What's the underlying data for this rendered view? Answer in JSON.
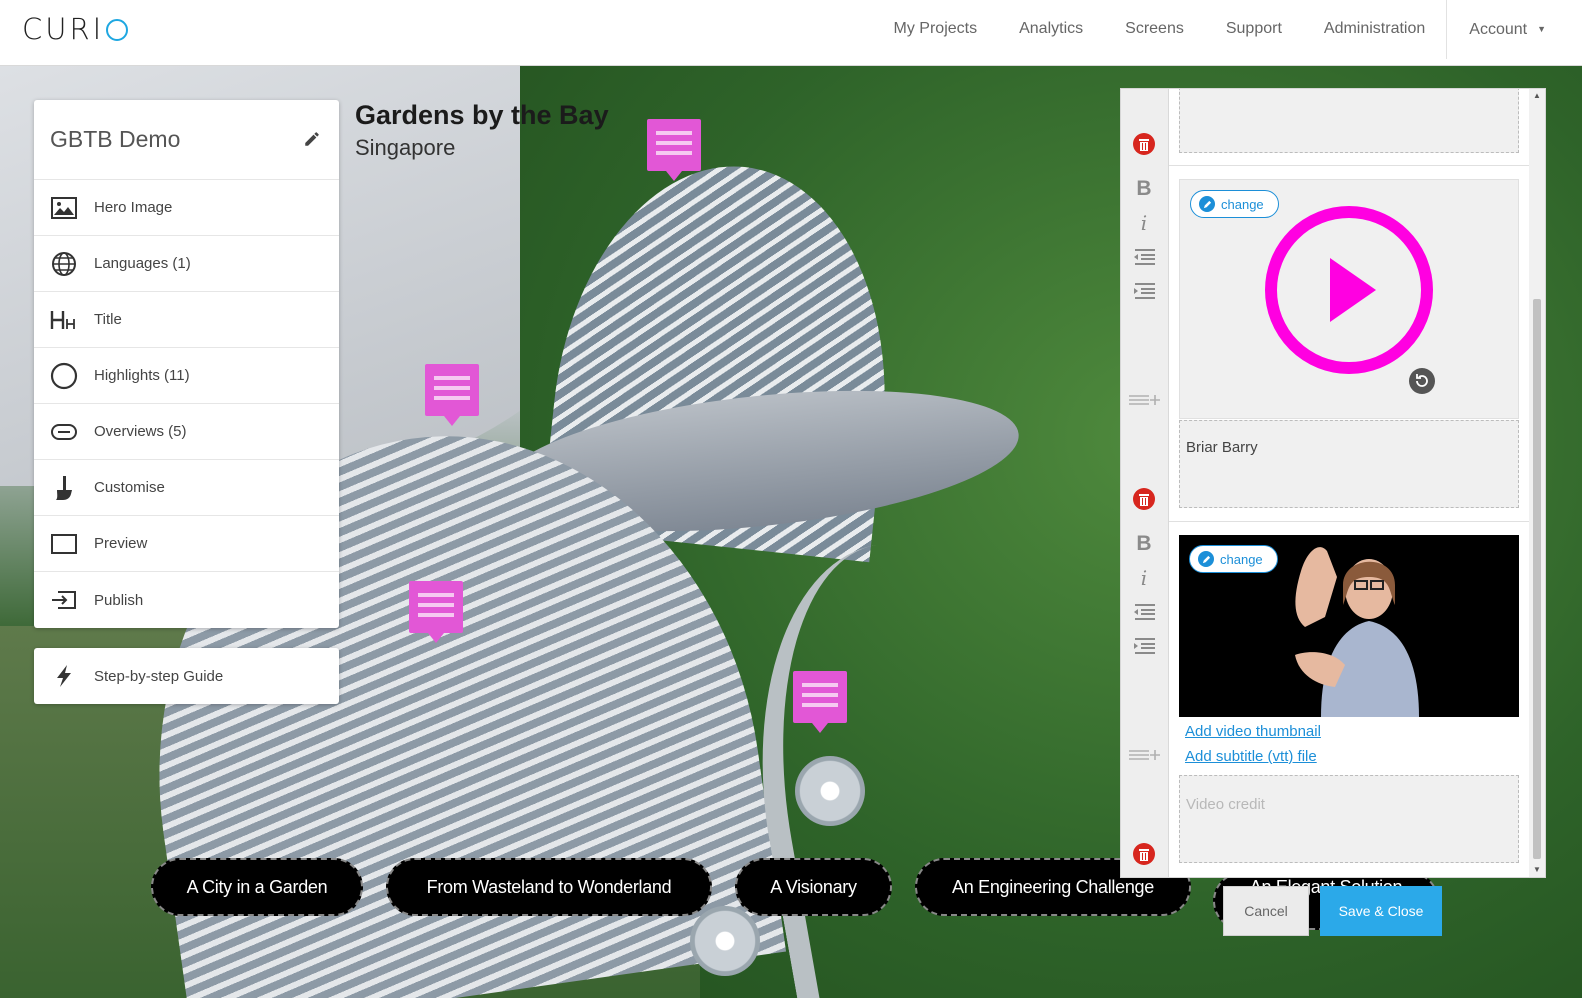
{
  "app": {
    "logo": "CURI",
    "nav": [
      "My Projects",
      "Analytics",
      "Screens",
      "Support",
      "Administration"
    ],
    "account": "Account"
  },
  "panel": {
    "title": "GBTB Demo",
    "items": [
      {
        "label": "Hero Image",
        "icon": "image-icon"
      },
      {
        "label": "Languages (1)",
        "icon": "globe-icon"
      },
      {
        "label": "Title",
        "icon": "heading-icon"
      },
      {
        "label": "Highlights (11)",
        "icon": "circle-icon"
      },
      {
        "label": "Overviews (5)",
        "icon": "pill-icon"
      },
      {
        "label": "Customise",
        "icon": "brush-icon"
      },
      {
        "label": "Preview",
        "icon": "preview-icon"
      },
      {
        "label": "Publish",
        "icon": "publish-icon"
      }
    ],
    "guide": "Step-by-step Guide"
  },
  "place": {
    "title": "Gardens by the Bay",
    "subtitle": "Singapore"
  },
  "pills": [
    "A City in a Garden",
    "From Wasteland to Wonderland",
    "A Visionary",
    "An Engineering Challenge",
    "An Elegant Solution"
  ],
  "editor": {
    "change_label": "change",
    "audio_credit": "Briar Barry",
    "add_thumbnail": "Add video thumbnail",
    "add_subtitle": "Add subtitle (vtt) file",
    "video_credit_placeholder": "Video credit",
    "accent_color": "#ff00e1"
  },
  "actions": {
    "cancel": "Cancel",
    "save": "Save & Close"
  }
}
